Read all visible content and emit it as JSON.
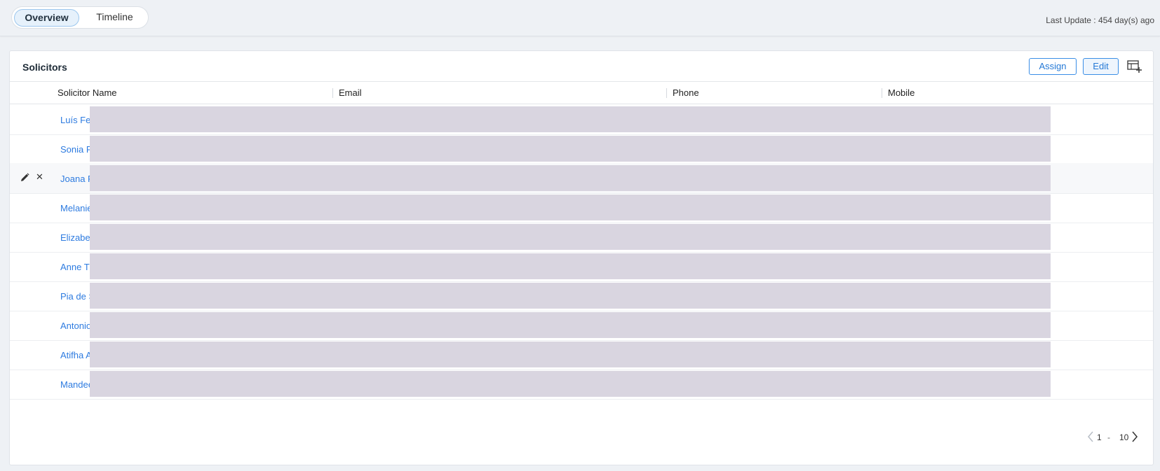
{
  "tabs": [
    {
      "label": "Overview",
      "active": true
    },
    {
      "label": "Timeline",
      "active": false
    }
  ],
  "last_update": "Last Update : 454 day(s) ago",
  "section": {
    "title": "Solicitors",
    "assign_label": "Assign",
    "edit_label": "Edit",
    "add_column_icon": "table-add-column-icon"
  },
  "table": {
    "columns": [
      "Solicitor Name",
      "Email",
      "Phone",
      "Mobile"
    ],
    "rows": [
      {
        "name": "Luís Fer"
      },
      {
        "name": "Sonia R"
      },
      {
        "name": "Joana F"
      },
      {
        "name": "Melanie"
      },
      {
        "name": "Elizabe"
      },
      {
        "name": "Anne T"
      },
      {
        "name": "Pia de S"
      },
      {
        "name": "Antonio"
      },
      {
        "name": "Atifha A"
      },
      {
        "name": "Mandee"
      }
    ]
  },
  "pagination": {
    "from": "1",
    "separator": "-",
    "to": "10"
  },
  "colors": {
    "accent": "#2d7be0",
    "redaction": "#d9d5e0",
    "background": "#eef1f5"
  }
}
